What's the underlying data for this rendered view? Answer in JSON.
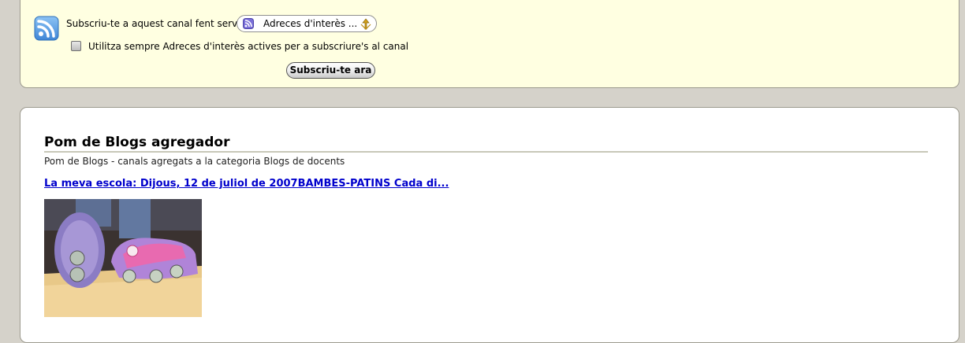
{
  "subscribe": {
    "label": "Subscriu-te a aquest canal fent servir",
    "reader_option": "Adreces d'interès ...",
    "always_use_label": "Utilitza sempre Adreces d'interès actives per a subscriure's al canal",
    "always_use_checked": false,
    "button_label": "Subscriu-te ara"
  },
  "feed": {
    "title": "Pom de Blogs agregador",
    "subtitle": "Pom de Blogs - canals agregats a la categoria Blogs de docents",
    "entries": [
      {
        "link_text": "La meva escola: Dijous, 12 de juliol de 2007BAMBES-PATINS Cada di...",
        "image_icon": "roller-shoes-photo",
        "cut_off_text": ""
      }
    ]
  },
  "colors": {
    "subscribe_bg": "#ffffe1",
    "page_bg": "#d5d2ca",
    "link": "#0000cc",
    "feed_icon": "#4a8fd9"
  }
}
